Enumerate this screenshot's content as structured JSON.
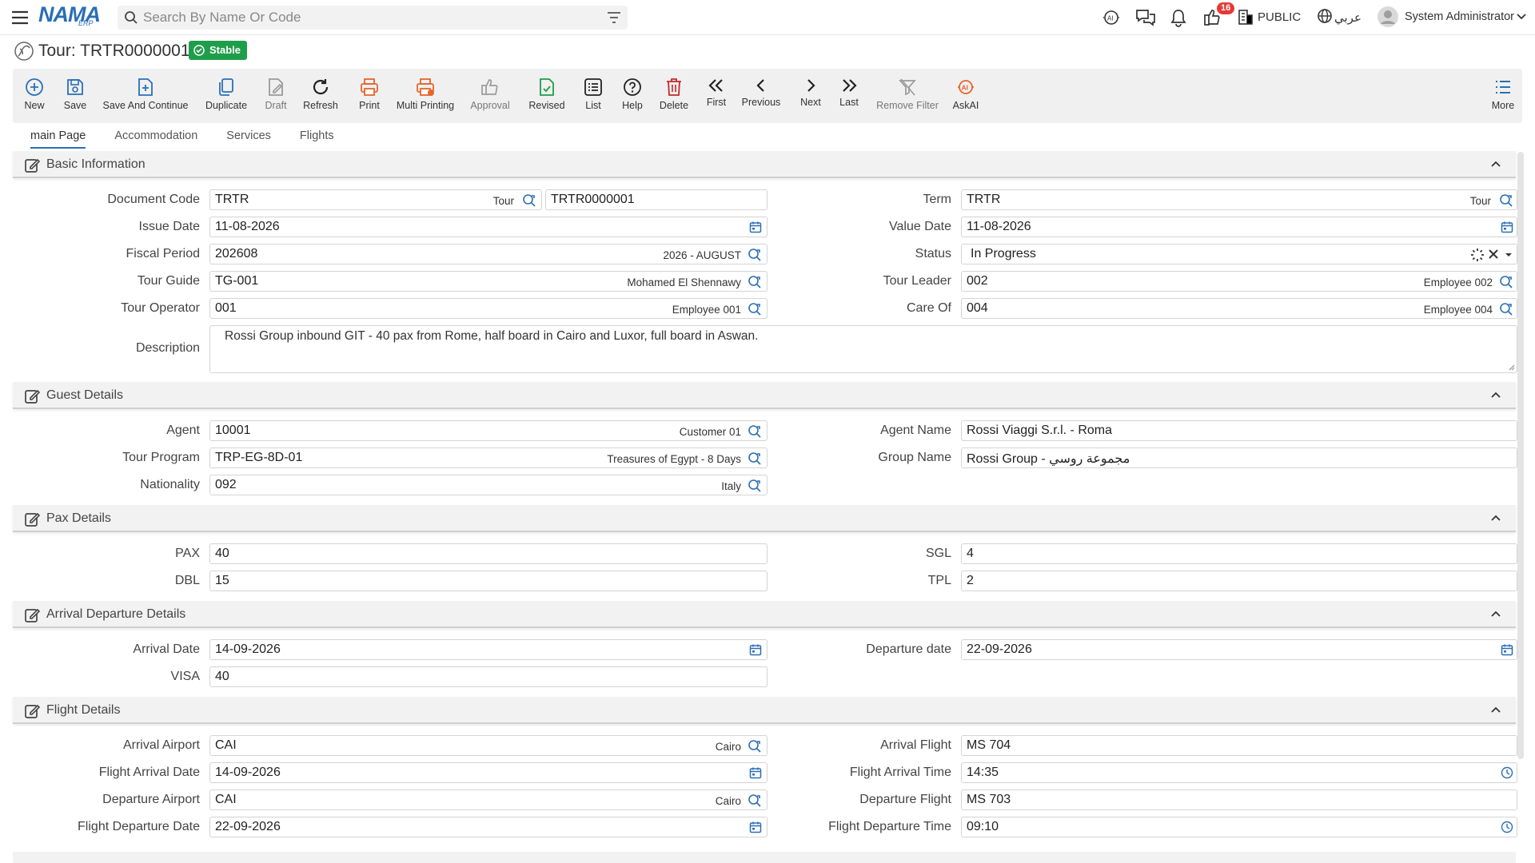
{
  "app": {
    "logo": "NAMA",
    "logo_sub": "ERP"
  },
  "search": {
    "placeholder": "Search By Name Or Code"
  },
  "topbar": {
    "notifications_count": "16",
    "public_label": "PUBLIC",
    "language_label": "عربي",
    "user_name": "System Administrator"
  },
  "page": {
    "title": "Tour: TRTR0000001",
    "status_badge": "Stable"
  },
  "toolbar": {
    "new": "New",
    "save": "Save",
    "save_continue": "Save And Continue",
    "duplicate": "Duplicate",
    "draft": "Draft",
    "refresh": "Refresh",
    "print": "Print",
    "multi_printing": "Multi Printing",
    "approval": "Approval",
    "revised": "Revised",
    "list": "List",
    "help": "Help",
    "delete": "Delete",
    "first": "First",
    "previous": "Previous",
    "next": "Next",
    "last": "Last",
    "remove_filter": "Remove Filter",
    "askai": "AskAI",
    "more": "More"
  },
  "tabs": [
    "main Page",
    "Accommodation",
    "Services",
    "Flights"
  ],
  "sections": {
    "basic": "Basic Information",
    "guest": "Guest Details",
    "pax": "Pax Details",
    "arrival": "Arrival Departure Details",
    "flight": "Flight Details"
  },
  "basic": {
    "document_code": {
      "label": "Document Code",
      "value": "TRTR",
      "hint": "Tour",
      "number": "TRTR0000001"
    },
    "term": {
      "label": "Term",
      "value": "TRTR",
      "hint": "Tour"
    },
    "issue_date": {
      "label": "Issue Date",
      "value": "11-08-2026"
    },
    "value_date": {
      "label": "Value Date",
      "value": "11-08-2026"
    },
    "fiscal_period": {
      "label": "Fiscal Period",
      "value": "202608",
      "hint": "2026 - AUGUST"
    },
    "status": {
      "label": "Status",
      "value": "In Progress"
    },
    "tour_guide": {
      "label": "Tour Guide",
      "value": "TG-001",
      "hint": "Mohamed El Shennawy"
    },
    "tour_leader": {
      "label": "Tour Leader",
      "value": "002",
      "hint": "Employee 002"
    },
    "tour_operator": {
      "label": "Tour Operator",
      "value": "001",
      "hint": "Employee 001"
    },
    "care_of": {
      "label": "Care Of",
      "value": "004",
      "hint": "Employee 004"
    },
    "description": {
      "label": "Description",
      "value": "Rossi Group inbound GIT - 40 pax from Rome, half board in Cairo and Luxor, full board in Aswan."
    }
  },
  "guest": {
    "agent": {
      "label": "Agent",
      "value": "10001",
      "hint": "Customer 01"
    },
    "agent_name": {
      "label": "Agent Name",
      "value": "Rossi Viaggi S.r.l. - Roma"
    },
    "tour_program": {
      "label": "Tour Program",
      "value": "TRP-EG-8D-01",
      "hint": "Treasures of Egypt - 8 Days"
    },
    "group_name": {
      "label": "Group Name",
      "value": "Rossi Group - مجموعة روسي"
    },
    "nationality": {
      "label": "Nationality",
      "value": "092",
      "hint": "Italy"
    }
  },
  "pax": {
    "pax": {
      "label": "PAX",
      "value": "40"
    },
    "sgl": {
      "label": "SGL",
      "value": "4"
    },
    "dbl": {
      "label": "DBL",
      "value": "15"
    },
    "tpl": {
      "label": "TPL",
      "value": "2"
    }
  },
  "arrival": {
    "arrival_date": {
      "label": "Arrival Date",
      "value": "14-09-2026"
    },
    "departure_date": {
      "label": "Departure date",
      "value": "22-09-2026"
    },
    "visa": {
      "label": "VISA",
      "value": "40"
    }
  },
  "flight": {
    "arrival_airport": {
      "label": "Arrival Airport",
      "value": "CAI",
      "hint": "Cairo"
    },
    "arrival_flight": {
      "label": "Arrival Flight",
      "value": "MS 704"
    },
    "flight_arrival_date": {
      "label": "Flight Arrival Date",
      "value": "14-09-2026"
    },
    "flight_arrival_time": {
      "label": "Flight Arrival Time",
      "value": "14:35"
    },
    "departure_airport": {
      "label": "Departure Airport",
      "value": "CAI",
      "hint": "Cairo"
    },
    "departure_flight": {
      "label": "Departure Flight",
      "value": "MS 703"
    },
    "flight_departure_date": {
      "label": "Flight Departure Date",
      "value": "22-09-2026"
    },
    "flight_departure_time": {
      "label": "Flight Departure Time",
      "value": "09:10"
    }
  },
  "colors": {
    "accent": "#2a6fb6",
    "success": "#1e9e4a",
    "danger": "#e53935",
    "orange": "#e8642c"
  }
}
